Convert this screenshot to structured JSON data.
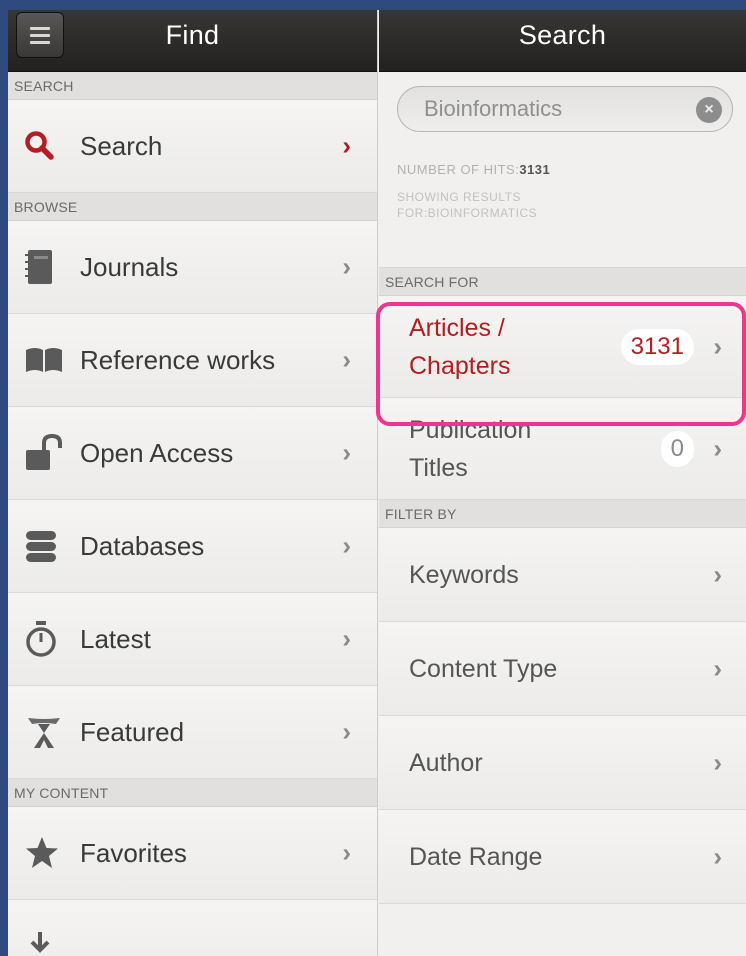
{
  "left": {
    "title": "Find",
    "sections": [
      {
        "header": "SEARCH",
        "items": [
          {
            "label": "Search",
            "icon": "search-icon",
            "accent": true
          }
        ]
      },
      {
        "header": "BROWSE",
        "items": [
          {
            "label": "Journals",
            "icon": "journal-icon"
          },
          {
            "label": "Reference works",
            "icon": "book-icon"
          },
          {
            "label": "Open Access",
            "icon": "unlock-icon"
          },
          {
            "label": "Databases",
            "icon": "database-icon"
          },
          {
            "label": "Latest",
            "icon": "stopwatch-icon"
          },
          {
            "label": "Featured",
            "icon": "ribbon-icon"
          }
        ]
      },
      {
        "header": "MY CONTENT",
        "items": [
          {
            "label": "Favorites",
            "icon": "star-icon"
          }
        ]
      }
    ]
  },
  "right": {
    "title": "Search",
    "search": {
      "value": "Bioinformatics"
    },
    "hits_label": "NUMBER OF HITS:",
    "hits_value": "3131",
    "showing_line1": "SHOWING RESULTS",
    "showing_line2": "FOR:BIOINFORMATICS",
    "search_for_header": "SEARCH FOR",
    "search_for": [
      {
        "label_line1": "Articles /",
        "label_line2": "Chapters",
        "count": "3131"
      },
      {
        "label_line1": "Publication",
        "label_line2": "Titles",
        "count": "0"
      }
    ],
    "filter_header": "FILTER BY",
    "filters": [
      "Keywords",
      "Content Type",
      "Author",
      "Date Range"
    ]
  },
  "colors": {
    "accent": "#b21e22",
    "highlight": "#f0348f",
    "navbar": "#2d2c2a",
    "outer": "#2e4a7e"
  }
}
